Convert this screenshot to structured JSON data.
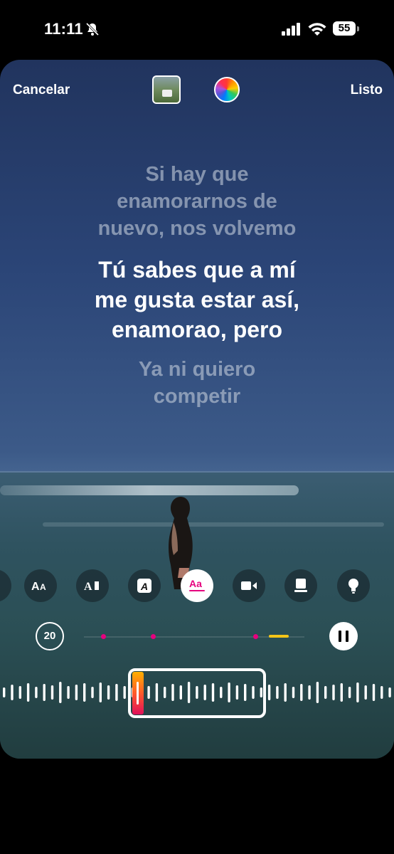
{
  "status_bar": {
    "time": "11:11",
    "battery": "55"
  },
  "header": {
    "cancel_label": "Cancelar",
    "done_label": "Listo"
  },
  "lyrics": {
    "previous": [
      "Si hay que",
      "enamorarnos de",
      "nuevo, nos volvemo"
    ],
    "current": [
      "Tú sabes que a mí",
      "me gusta estar así,",
      "enamorao, pero"
    ],
    "next": [
      "Ya ni quiero",
      "competir"
    ]
  },
  "tools": [
    {
      "icon": "text-size-icon"
    },
    {
      "icon": "text-style-icon"
    },
    {
      "icon": "italic-text-icon"
    },
    {
      "icon": "lyrics-text-icon",
      "selected": true
    },
    {
      "icon": "video-icon"
    },
    {
      "icon": "cover-card-icon"
    },
    {
      "icon": "lightbulb-icon"
    }
  ],
  "timeline": {
    "duration": "20"
  },
  "colors": {
    "accent_pink": "#e6007e",
    "accent_yellow": "#f5c518",
    "handle_gradient": [
      "#ffb000",
      "#ff5a2a",
      "#e0105a"
    ]
  }
}
